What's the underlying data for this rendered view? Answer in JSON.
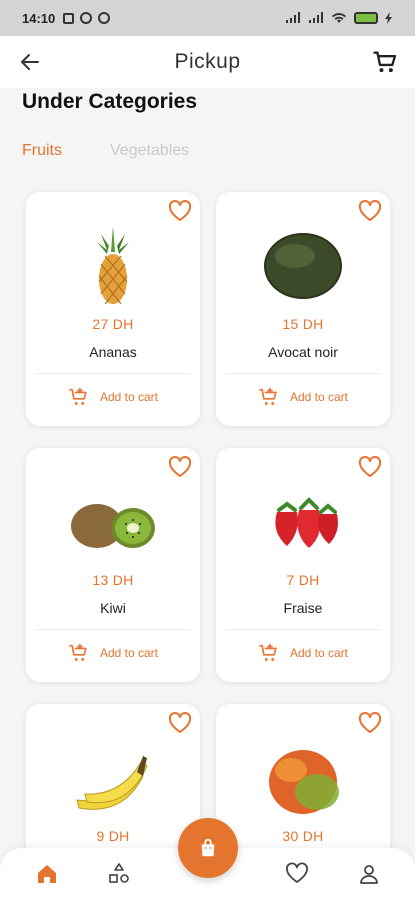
{
  "status_bar": {
    "time": "14:10"
  },
  "app_bar": {
    "title": "Pickup"
  },
  "section": {
    "title": "Under Categories"
  },
  "tabs": [
    {
      "label": "Fruits",
      "active": true
    },
    {
      "label": "Vegetables",
      "active": false
    }
  ],
  "products": [
    {
      "name": "Ananas",
      "price": "27 DH",
      "add_label": "Add to cart",
      "image": "pineapple"
    },
    {
      "name": "Avocat noir",
      "price": "15 DH",
      "add_label": "Add to cart",
      "image": "avocado"
    },
    {
      "name": "Kiwi",
      "price": "13 DH",
      "add_label": "Add to cart",
      "image": "kiwi"
    },
    {
      "name": "Fraise",
      "price": "7 DH",
      "add_label": "Add to cart",
      "image": "strawberry"
    },
    {
      "name": "",
      "price": "9 DH",
      "add_label": "",
      "image": "banana"
    },
    {
      "name": "",
      "price": "30 DH",
      "add_label": "",
      "image": "mango"
    }
  ],
  "bottom_nav": [
    {
      "icon": "home-icon",
      "active": true
    },
    {
      "icon": "categories-icon",
      "active": false
    },
    {
      "icon": "shopping-bag-icon",
      "active": false
    },
    {
      "icon": "heart-icon",
      "active": false
    },
    {
      "icon": "user-icon",
      "active": false
    }
  ],
  "colors": {
    "accent": "#e5742e",
    "inactive_tab": "#c9c9c9"
  }
}
